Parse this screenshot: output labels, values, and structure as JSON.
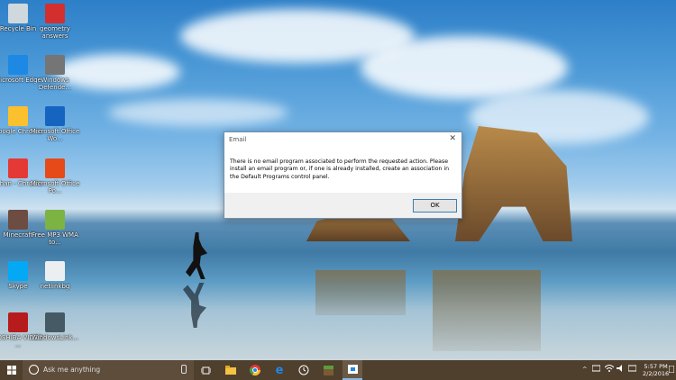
{
  "desktop": {
    "icons": [
      {
        "label": "Recycle Bin",
        "icon": "recycle-bin-icon",
        "color": "#cfd8dc"
      },
      {
        "label": "geometry answers",
        "icon": "pdf-icon",
        "color": "#d32f2f"
      },
      {
        "label": "Microsoft Edge",
        "icon": "edge-icon",
        "color": "#1e88e5"
      },
      {
        "label": "Windows Defende...",
        "icon": "defender-icon",
        "color": "#757575"
      },
      {
        "label": "Google Chrome",
        "icon": "chrome-icon",
        "color": "#fbc02d"
      },
      {
        "label": "Microsoft Office Wo...",
        "icon": "word-icon",
        "color": "#1565c0"
      },
      {
        "label": "Ethan - Chrome",
        "icon": "chrome-icon",
        "color": "#e53935"
      },
      {
        "label": "Microsoft Office Po...",
        "icon": "powerpoint-icon",
        "color": "#e64a19"
      },
      {
        "label": "Minecraft",
        "icon": "minecraft-icon",
        "color": "#6d4c41"
      },
      {
        "label": "Free MP3 WMA to...",
        "icon": "audio-converter-icon",
        "color": "#7cb342"
      },
      {
        "label": "Skype",
        "icon": "skype-icon",
        "color": "#03a9f4"
      },
      {
        "label": "netlinkbg",
        "icon": "text-file-icon",
        "color": "#eceff1"
      },
      {
        "label": "TOSHIBA VIDEO ...",
        "icon": "toshiba-video-icon",
        "color": "#b71c1c"
      },
      {
        "label": "WindowsLink...",
        "icon": "shortcut-icon",
        "color": "#455a64"
      }
    ]
  },
  "dialog": {
    "title": "Email",
    "close_glyph": "✕",
    "message": "There is no email program associated to perform the requested action. Please install an email program or, if one is already installed, create an association in the Default Programs control panel.",
    "ok_label": "OK"
  },
  "taskbar": {
    "search_placeholder": "Ask me anything",
    "time": "5:57 PM",
    "date": "2/2/2016",
    "pinned": [
      "task-view-icon",
      "file-explorer-icon",
      "chrome-icon",
      "edge-icon",
      "alarm-icon",
      "minecraft-icon",
      "store-icon"
    ],
    "colors": {
      "bar": "#4f3f2d",
      "accent": "#1e88e5"
    }
  }
}
